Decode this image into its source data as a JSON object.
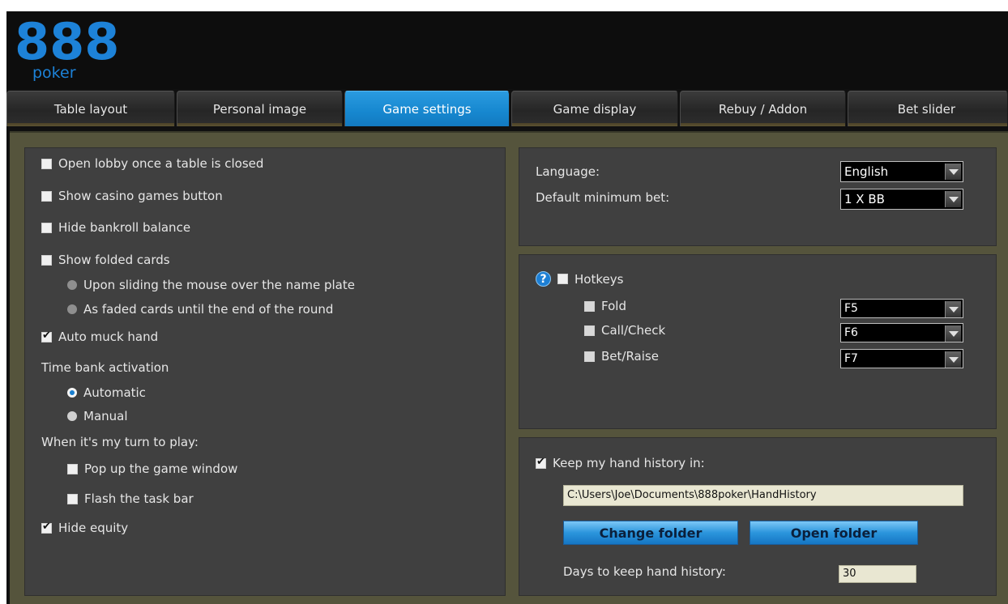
{
  "brand": {
    "digits": "888",
    "name": "poker",
    "color": "#1d82d8"
  },
  "tabs": [
    {
      "label": "Table layout",
      "active": false
    },
    {
      "label": "Personal image",
      "active": false
    },
    {
      "label": "Game settings",
      "active": true
    },
    {
      "label": "Game display",
      "active": false
    },
    {
      "label": "Rebuy / Addon",
      "active": false
    },
    {
      "label": "Bet slider",
      "active": false
    }
  ],
  "left": {
    "open_lobby": {
      "label": "Open lobby once a table is closed",
      "checked": false
    },
    "casino_button": {
      "label": "Show casino games button",
      "checked": false
    },
    "hide_bankroll": {
      "label": "Hide bankroll balance",
      "checked": false
    },
    "show_folded": {
      "label": "Show folded cards",
      "checked": false
    },
    "folded_opt1": {
      "label": "Upon sliding the mouse over the name plate"
    },
    "folded_opt2": {
      "label": "As faded cards until the end of the round"
    },
    "auto_muck": {
      "label": "Auto muck hand",
      "checked": true
    },
    "time_bank_label": "Time bank activation",
    "time_bank_auto": {
      "label": "Automatic",
      "selected": true
    },
    "time_bank_manual": {
      "label": "Manual",
      "selected": false
    },
    "my_turn_label": "When it's my turn to play:",
    "popup_window": {
      "label": "Pop up the game window",
      "checked": false
    },
    "flash_taskbar": {
      "label": "Flash the task bar",
      "checked": false
    },
    "hide_equity": {
      "label": "Hide equity",
      "checked": true
    }
  },
  "language": {
    "label": "Language:",
    "value": "English",
    "min_bet_label": "Default minimum bet:",
    "min_bet_value": "1 X BB"
  },
  "hotkeys": {
    "help_glyph": "?",
    "label": "Hotkeys",
    "items": [
      {
        "label": "Fold",
        "key": "F5"
      },
      {
        "label": "Call/Check",
        "key": "F6"
      },
      {
        "label": "Bet/Raise",
        "key": "F7"
      }
    ]
  },
  "history": {
    "keep_label": "Keep my hand history in:",
    "keep_checked": true,
    "path": "C:\\Users\\Joe\\Documents\\888poker\\HandHistory",
    "change_folder": "Change folder",
    "open_folder": "Open folder",
    "days_label": "Days to keep hand history:",
    "days_value": "30"
  },
  "colors": {
    "accent": "#1687cf",
    "panel": "#404040",
    "content_bg": "#55543c",
    "header_bg": "#0d0d0d"
  }
}
